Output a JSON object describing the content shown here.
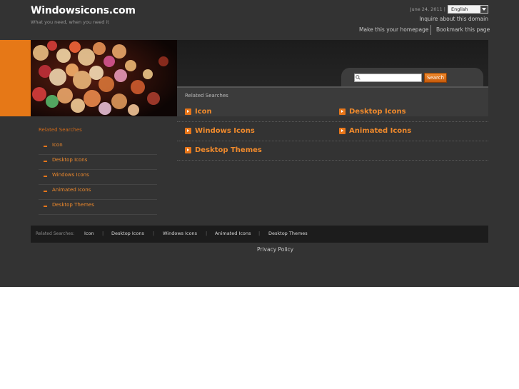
{
  "header": {
    "site_title": "Windowsicons.com",
    "tagline": "What you need, when you need it",
    "date": "June 24, 2011 |",
    "language": "English",
    "inquire": "Inquire about this domain",
    "homepage_link": "Make this your homepage",
    "bookmark_link": "Bookmark this page"
  },
  "search": {
    "placeholder": "",
    "button_label": "Search"
  },
  "main": {
    "heading": "Related Searches",
    "links": [
      "Icon",
      "Desktop Icons",
      "Windows Icons",
      "Animated Icons",
      "Desktop Themes"
    ]
  },
  "sidebar": {
    "heading": "Related Searches",
    "items": [
      "Icon",
      "Desktop Icons",
      "Windows Icons",
      "Animated Icons",
      "Desktop Themes"
    ]
  },
  "footer": {
    "label": "Related Searches:",
    "links": [
      "Icon",
      "Desktop Icons",
      "Windows Icons",
      "Animated Icons",
      "Desktop Themes"
    ],
    "separator": "|",
    "privacy": "Privacy Policy"
  },
  "colors": {
    "accent": "#e67817",
    "link": "#f08a2c",
    "background": "#333333"
  }
}
